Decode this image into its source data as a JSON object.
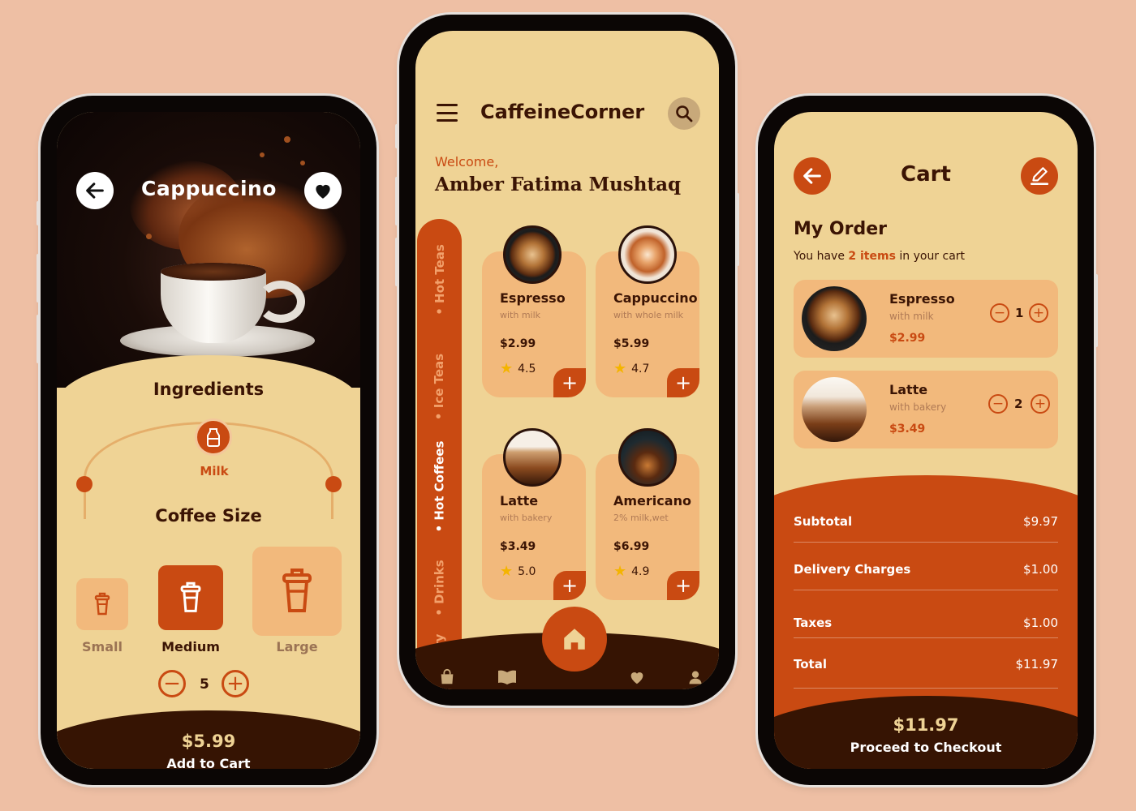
{
  "colors": {
    "background": "#EEBFA4",
    "cream": "#EFD395",
    "accent": "#C94A12",
    "dark": "#361403",
    "card": "#F2B97C",
    "text": "#3b1404"
  },
  "detail": {
    "title": "Cappuccino",
    "back_icon": "arrow-left-icon",
    "favorite_icon": "heart-icon",
    "ingredients_title": "Ingredients",
    "ingredient": {
      "label": "Milk",
      "icon": "milk-bottle-icon"
    },
    "size_title": "Coffee Size",
    "sizes": [
      {
        "label": "Small",
        "selected": false
      },
      {
        "label": "Medium",
        "selected": true
      },
      {
        "label": "Large",
        "selected": false
      }
    ],
    "quantity": "5",
    "minus": "−",
    "plus": "+",
    "price": "$5.99",
    "cta": "Add to Cart"
  },
  "home": {
    "app_name": "CaffeineCorner",
    "welcome": "Welcome,",
    "user_name": "Amber Fatima Mushtaq",
    "categories": [
      {
        "label": "Hot Teas",
        "active": false
      },
      {
        "label": "Ice Teas",
        "active": false
      },
      {
        "label": "Hot Coffees",
        "active": true
      },
      {
        "label": "Drinks",
        "active": false
      },
      {
        "label": "kery",
        "active": false
      }
    ],
    "products": [
      {
        "name": "Espresso",
        "sub": "with milk",
        "price": "$2.99",
        "rating": "4.5"
      },
      {
        "name": "Cappuccino",
        "sub": "with whole milk",
        "price": "$5.99",
        "rating": "4.7"
      },
      {
        "name": "Latte",
        "sub": "with bakery",
        "price": "$3.49",
        "rating": "5.0"
      },
      {
        "name": "Americano",
        "sub": "2% milk,wet",
        "price": "$6.99",
        "rating": "4.9"
      }
    ],
    "add_label": "+",
    "nav": [
      "bag-icon",
      "menu-book-icon",
      "home-icon",
      "heart-icon",
      "profile-icon"
    ]
  },
  "cart": {
    "title": "Cart",
    "heading": "My Order",
    "sub_prefix": "You have",
    "sub_count": "2 items",
    "sub_suffix": "in your cart",
    "items": [
      {
        "name": "Espresso",
        "sub": "with milk",
        "price": "$2.99",
        "qty": "1"
      },
      {
        "name": "Latte",
        "sub": "with bakery",
        "price": "$3.49",
        "qty": "2"
      }
    ],
    "summary": [
      {
        "label": "Subtotal",
        "value": "$9.97"
      },
      {
        "label": "Delivery Charges",
        "value": "$1.00"
      },
      {
        "label": "Taxes",
        "value": "$1.00"
      },
      {
        "label": "Total",
        "value": "$11.97"
      }
    ],
    "total": "$11.97",
    "cta": "Proceed to Checkout"
  }
}
